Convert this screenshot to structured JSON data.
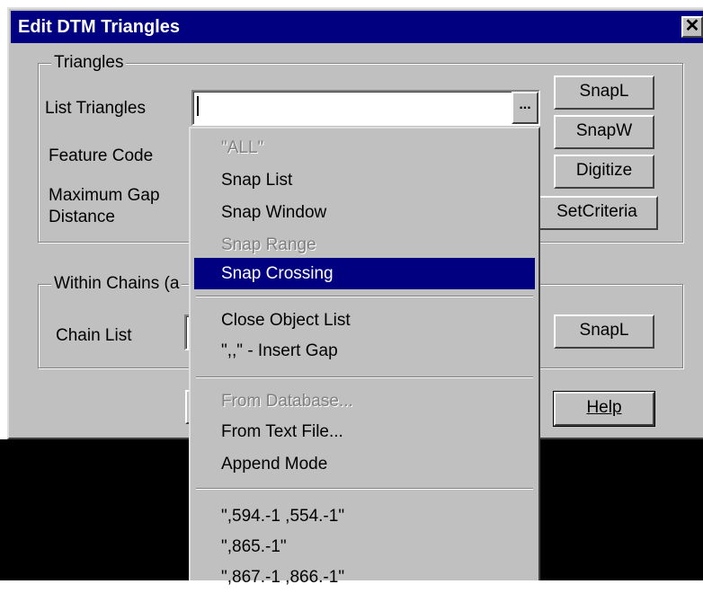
{
  "window": {
    "title": "Edit DTM Triangles",
    "close_label": "✕"
  },
  "triangles_group": {
    "title": "Triangles",
    "list_triangles_label": "List Triangles",
    "list_triangles_value": "",
    "browse_label": "...",
    "feature_code_label": "Feature Code",
    "max_gap_label_1": "Maximum Gap",
    "max_gap_label_2": "Distance",
    "buttons": {
      "snapl": "SnapL",
      "snapw": "SnapW",
      "digitize": "Digitize",
      "setcriteria": "SetCriteria"
    }
  },
  "chains_group": {
    "title": "Within Chains (a",
    "chain_list_label": "Chain List",
    "snapl": "SnapL"
  },
  "footer": {
    "help_label": "Help"
  },
  "dropdown": {
    "items": [
      {
        "label": "\"ALL\"",
        "disabled": true
      },
      {
        "label": "Snap List"
      },
      {
        "label": "Snap Window"
      },
      {
        "label": "Snap Range",
        "disabled": true
      },
      {
        "label": "Snap Crossing",
        "selected": true
      },
      {
        "label": "Close Object List"
      },
      {
        "label": "\",,\" - Insert Gap"
      },
      {
        "label": "From Database...",
        "disabled": true
      },
      {
        "label": "From Text File..."
      },
      {
        "label": "Append Mode"
      },
      {
        "label": "\",594.-1 ,554.-1\""
      },
      {
        "label": "\",865.-1\""
      },
      {
        "label": "\",867.-1 ,866.-1\""
      }
    ]
  },
  "colors": {
    "face": "#c0c0c0",
    "title_bar": "#000080",
    "highlight": "#000080",
    "disabled_text": "#808080"
  }
}
